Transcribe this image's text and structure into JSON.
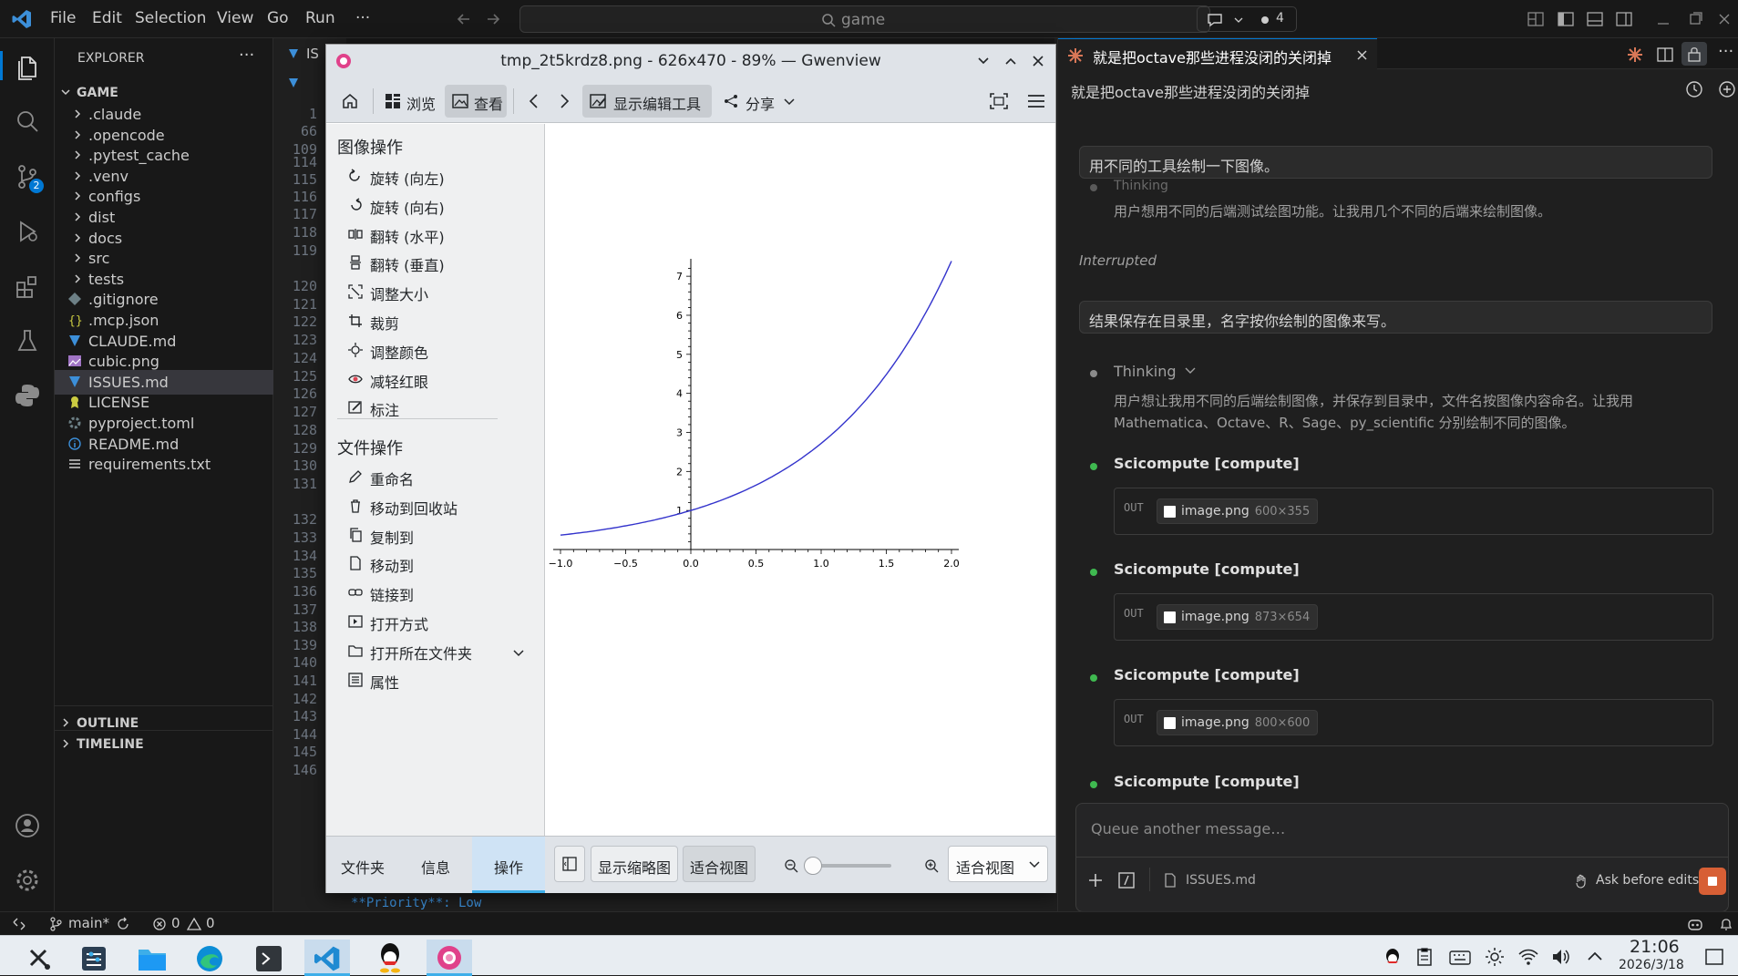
{
  "titlebar": {
    "menus": [
      "File",
      "Edit",
      "Selection",
      "View",
      "Go",
      "Run",
      "···"
    ],
    "search": "game",
    "agent_count": "4"
  },
  "explorer": {
    "header": "EXPLORER",
    "root": "GAME",
    "items": [
      {
        "label": ".claude",
        "type": "folder"
      },
      {
        "label": ".opencode",
        "type": "folder"
      },
      {
        "label": ".pytest_cache",
        "type": "folder"
      },
      {
        "label": ".venv",
        "type": "folder"
      },
      {
        "label": "configs",
        "type": "folder"
      },
      {
        "label": "dist",
        "type": "folder"
      },
      {
        "label": "docs",
        "type": "folder"
      },
      {
        "label": "src",
        "type": "folder"
      },
      {
        "label": "tests",
        "type": "folder"
      },
      {
        "label": ".gitignore",
        "type": "file"
      },
      {
        "label": ".mcp.json",
        "type": "file"
      },
      {
        "label": "CLAUDE.md",
        "type": "file"
      },
      {
        "label": "cubic.png",
        "type": "file"
      },
      {
        "label": "ISSUES.md",
        "type": "file"
      },
      {
        "label": "LICENSE",
        "type": "file"
      },
      {
        "label": "pyproject.toml",
        "type": "file"
      },
      {
        "label": "README.md",
        "type": "file"
      },
      {
        "label": "requirements.txt",
        "type": "file"
      }
    ],
    "outline": "OUTLINE",
    "timeline": "TIMELINE",
    "scm_badge": "2"
  },
  "editor": {
    "tab_label": "IS",
    "line_numbers": [
      "1",
      "66",
      "109",
      "114",
      "115",
      "116",
      "117",
      "118",
      "119",
      "120",
      "121",
      "122",
      "123",
      "124",
      "125",
      "126",
      "127",
      "128",
      "129",
      "130",
      "131",
      "132",
      "133",
      "134",
      "135",
      "136",
      "137",
      "138",
      "139",
      "140",
      "141",
      "142",
      "143",
      "144",
      "145",
      "146"
    ],
    "bottom_text": "**Priority**: Low"
  },
  "gwenview": {
    "title": "tmp_2t5krdz8.png - 626x470 - 89% — Gwenview",
    "toolbar": {
      "browse": "浏览",
      "view": "查看",
      "show_editor": "显示编辑工具",
      "share": "分享"
    },
    "image_ops_header": "图像操作",
    "image_ops": [
      "旋转 (向左)",
      "旋转 (向右)",
      "翻转 (水平)",
      "翻转 (垂直)",
      "调整大小",
      "裁剪",
      "调整颜色",
      "减轻红眼",
      "标注"
    ],
    "file_ops_header": "文件操作",
    "file_ops": [
      "重命名",
      "移动到回收站",
      "复制到",
      "移动到",
      "链接到",
      "打开方式",
      "打开所在文件夹",
      "属性"
    ],
    "bottom_tabs": [
      "文件夹",
      "信息",
      "操作"
    ],
    "show_thumbnails": "显示缩略图",
    "fit_view": "适合视图",
    "zoom_select": "适合视图"
  },
  "chart_data": {
    "type": "line",
    "function": "exp(x)",
    "x_range": [
      -1.0,
      2.0
    ],
    "x": [
      -1.0,
      -0.75,
      -0.5,
      -0.25,
      0.0,
      0.25,
      0.5,
      0.75,
      1.0,
      1.25,
      1.5,
      1.75,
      2.0
    ],
    "y": [
      0.368,
      0.472,
      0.607,
      0.779,
      1.0,
      1.284,
      1.649,
      2.117,
      2.718,
      3.49,
      4.482,
      5.755,
      7.389
    ],
    "x_ticks": [
      "−1.0",
      "−0.5",
      "0.0",
      "0.5",
      "1.0",
      "1.5",
      "2.0"
    ],
    "y_ticks": [
      "1",
      "2",
      "3",
      "4",
      "5",
      "6",
      "7"
    ],
    "ylim": [
      0,
      7.4
    ],
    "series_color": "#3333cc",
    "grid": false
  },
  "chat": {
    "tab_title": "就是把octave那些进程没闭的关闭掉",
    "header": "就是把octave那些进程没闭的关闭掉",
    "msg1": "用不同的工具绘制一下图像。",
    "thinking_faded": "Thinking",
    "thinking1": "用户想用不同的后端测试绘图功能。让我用几个不同的后端来绘制图像。",
    "interrupted": "Interrupted",
    "msg2": "结果保存在目录里，名字按你绘制的图像来写。",
    "thinking_label": "Thinking",
    "thinking2_line1": "用户想让我用不同的后端绘制图像，并保存到目录中，文件名按图像内容命名。让我用",
    "thinking2_line2": "Mathematica、Octave、R、Sage、py_scientific 分别绘制不同的图像。",
    "tools": [
      {
        "title": "Scicompute [compute]",
        "file": "image.png",
        "dims": "600×355"
      },
      {
        "title": "Scicompute [compute]",
        "file": "image.png",
        "dims": "873×654"
      },
      {
        "title": "Scicompute [compute]",
        "file": "image.png",
        "dims": "800×600"
      },
      {
        "title": "Scicompute [compute]"
      }
    ],
    "out_label": "OUT",
    "queue_placeholder": "Queue another message…",
    "attached_file": "ISSUES.md",
    "ask_before_edits": "Ask before edits"
  },
  "statusbar": {
    "branch": "main*",
    "errors": "0",
    "warnings": "0"
  },
  "taskbar": {
    "time": "21:06",
    "date": "2026/3/18"
  }
}
